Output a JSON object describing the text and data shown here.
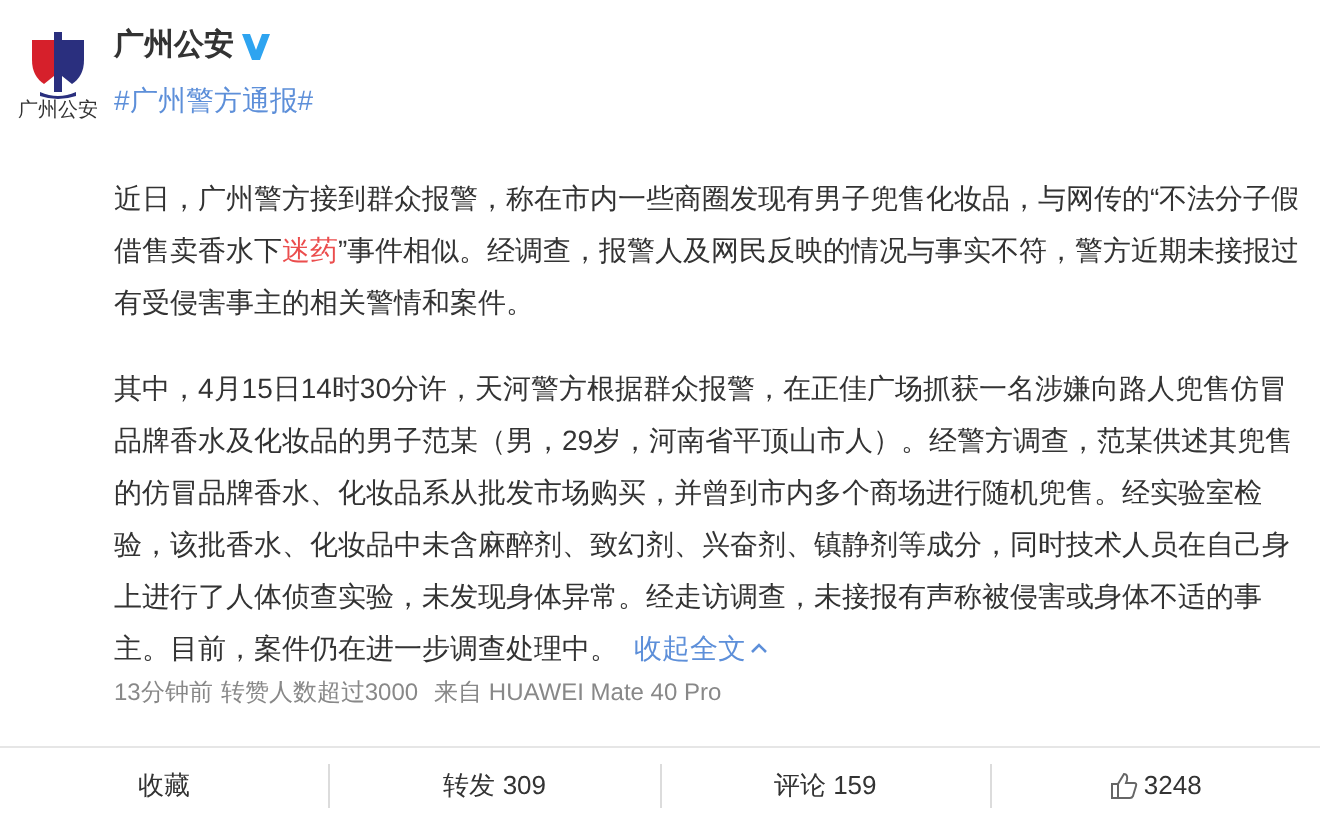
{
  "account": {
    "name": "广州公安",
    "verified": true,
    "logo_text": "广州公安"
  },
  "hashtag": "#广州警方通报#",
  "paragraphs": [
    {
      "segments": [
        {
          "text": "近日，广州警方接到群众报警，称在市内一些商圈发现有男子兜售化妆品，与网传的“不法分子假借售卖香水下",
          "kind": "plain"
        },
        {
          "text": "迷药",
          "kind": "keyword"
        },
        {
          "text": "”事件相似。经调查，报警人及网民反映的情况与事实不符，警方近期未接报过有受侵害事主的相关警情和案件。",
          "kind": "plain"
        }
      ]
    },
    {
      "segments": [
        {
          "text": "其中，4月15日14时30分许，天河警方根据群众报警，在正佳广场抓获一名涉嫌向路人兜售仿冒品牌香水及化妆品的男子范某（男，29岁，河南省平顶山市人）。经警方调查，范某供述其兜售的仿冒品牌香水、化妆品系从批发市场购买，并曾到市内多个商场进行随机兜售。经实验室检验，该批香水、化妆品中未含麻醉剂、致幻剂、兴奋剂、镇静剂等成分，同时技术人员在自己身上进行了人体侦查实验，未发现身体异常。经走访调查，未接报有声称被侵害或身体不适的事主。目前，案件仍在进一步调查处理中。",
          "kind": "plain"
        }
      ],
      "collapse_link": "收起全文"
    }
  ],
  "meta": {
    "time": "13分钟前",
    "reposts_note": "转赞人数超过3000",
    "source": "来自 HUAWEI Mate 40 Pro"
  },
  "actions": [
    {
      "kind": "favorite",
      "label": "收藏"
    },
    {
      "kind": "repost",
      "label": "转发 309"
    },
    {
      "kind": "comment",
      "label": "评论 159"
    },
    {
      "kind": "like",
      "label": "3248"
    }
  ]
}
